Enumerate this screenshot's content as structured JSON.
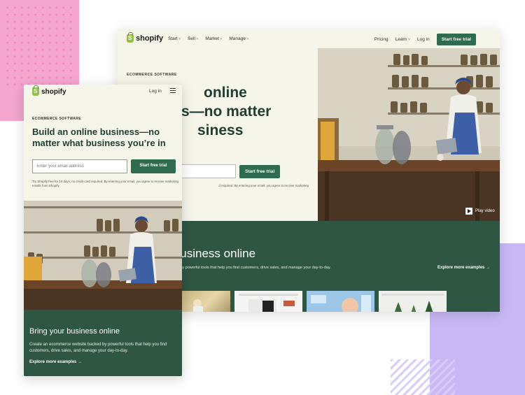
{
  "brand": {
    "name": "shopify",
    "accent": "#2e6b4f",
    "band": "#2f5543",
    "cream": "#f6f5e9"
  },
  "desktop": {
    "nav": {
      "menu": [
        "Start",
        "Sell",
        "Market",
        "Manage"
      ],
      "right": [
        "Pricing",
        "Learn",
        "Log in"
      ],
      "cta": "Start free trial"
    },
    "hero": {
      "eyebrow": "ECOMMERCE SOFTWARE",
      "title_lines": [
        "online",
        "s—no matter",
        "siness",
        ""
      ],
      "cta": "Start free trial",
      "fine_print": "d required. By entering your email, you agree to receive marketing"
    },
    "play_video": "Play video",
    "band": {
      "title": "ur business online",
      "text": "site backed by powerful tools that help you find customers, drive sales, and manage your day-to-day.",
      "explore": "Explore more examples →"
    }
  },
  "mobile": {
    "login": "Log in",
    "eyebrow": "ECOMMERCE SOFTWARE",
    "title": "Build an online business—no matter what business you’re in",
    "email_placeholder": "Enter your email address",
    "cta": "Start free trial",
    "fine_print": "Try Shopify free for 14 days, no credit card required. By entering your email, you agree to receive marketing emails from Shopify.",
    "band": {
      "title": "Bring your business online",
      "text": "Create an ecommerce website backed by powerful tools that help you find customers, drive sales, and manage your day-to-day.",
      "explore": "Explore more examples →"
    }
  }
}
